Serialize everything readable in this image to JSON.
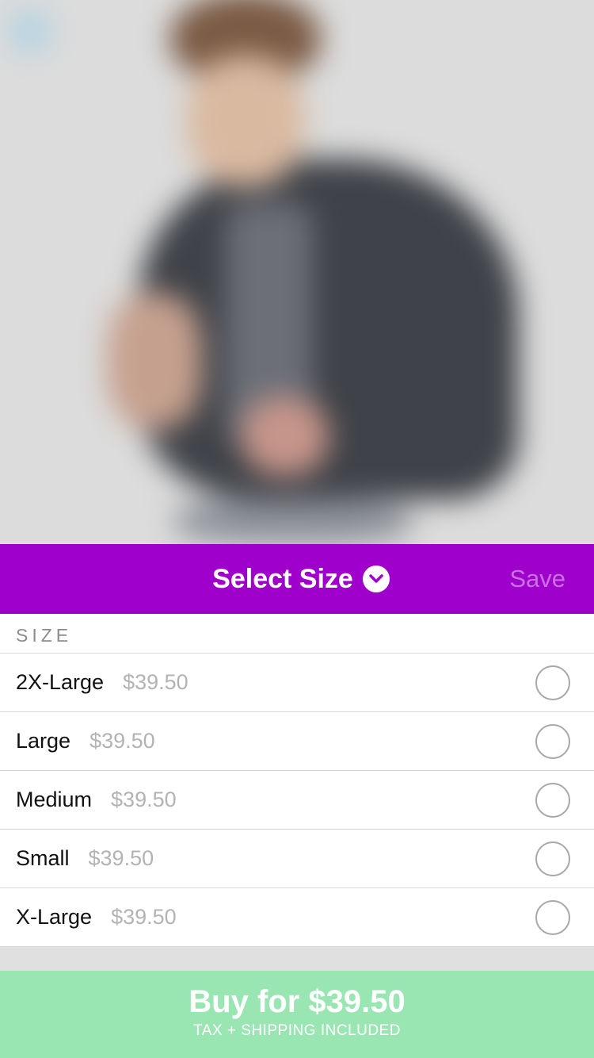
{
  "header": {
    "title": "Select Size",
    "title_icon": "chevron-down-circle-icon",
    "save_label": "Save",
    "background": "#a000cc"
  },
  "sizes": {
    "section_label": "SIZE",
    "items": [
      {
        "name": "2X-Large",
        "price": "$39.50",
        "selected": false
      },
      {
        "name": "Large",
        "price": "$39.50",
        "selected": false
      },
      {
        "name": "Medium",
        "price": "$39.50",
        "selected": false
      },
      {
        "name": "Small",
        "price": "$39.50",
        "selected": false
      },
      {
        "name": "X-Large",
        "price": "$39.50",
        "selected": false
      }
    ]
  },
  "buy": {
    "label": "Buy for $39.50",
    "subtitle": "TAX + SHIPPING INCLUDED",
    "background": "#99e6b3"
  }
}
